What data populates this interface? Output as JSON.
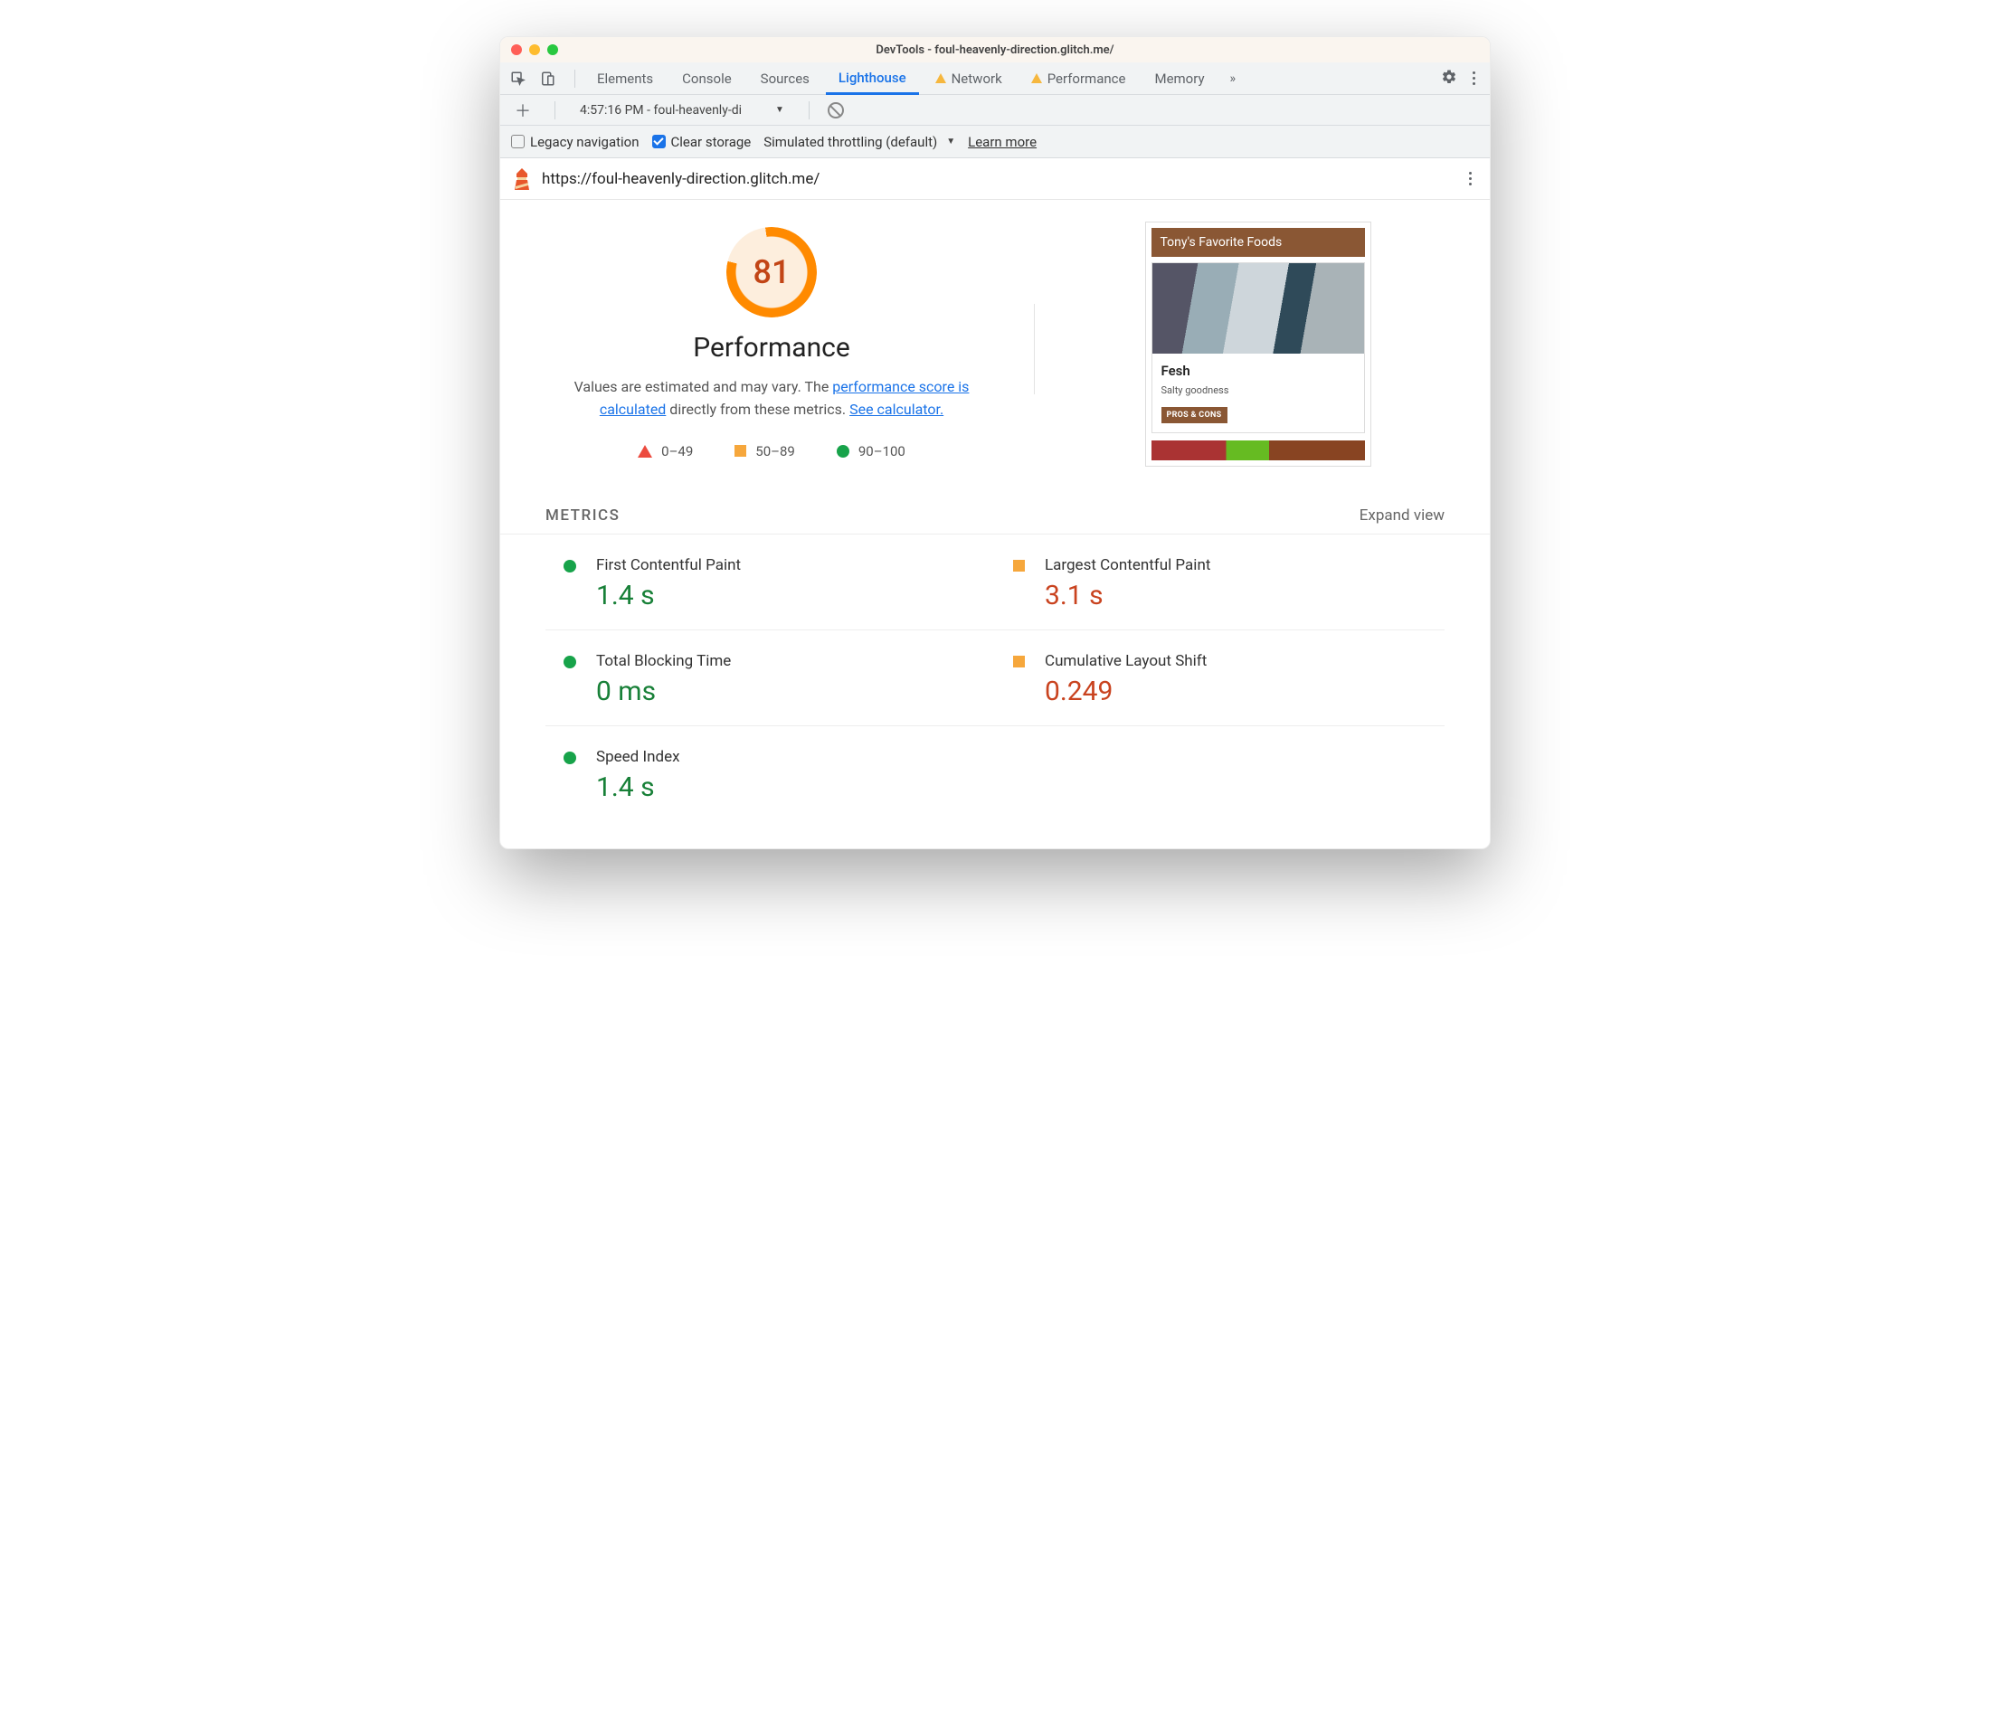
{
  "window": {
    "title": "DevTools - foul-heavenly-direction.glitch.me/"
  },
  "tabs": {
    "items": [
      "Elements",
      "Console",
      "Sources",
      "Lighthouse",
      "Network",
      "Performance",
      "Memory"
    ],
    "active": "Lighthouse",
    "warn": [
      "Network",
      "Performance"
    ]
  },
  "toolbar": {
    "run_label": "4:57:16 PM - foul-heavenly-di"
  },
  "options": {
    "legacy_label": "Legacy navigation",
    "clear_label": "Clear storage",
    "throttling_label": "Simulated throttling (default)",
    "learn_more": "Learn more"
  },
  "url": "https://foul-heavenly-direction.glitch.me/",
  "gauge": {
    "score": "81",
    "category": "Performance"
  },
  "desc": {
    "pre": "Values are estimated and may vary. The ",
    "link1": "performance score is calculated",
    "mid": " directly from these metrics. ",
    "link2": "See calculator."
  },
  "legend": {
    "a": "0–49",
    "b": "50–89",
    "c": "90–100"
  },
  "preview": {
    "header": "Tony's Favorite Foods",
    "card_title": "Fesh",
    "card_sub": "Salty goodness",
    "card_btn": "PROS & CONS"
  },
  "metrics_header": "METRICS",
  "expand_label": "Expand view",
  "metrics": [
    {
      "label": "First Contentful Paint",
      "value": "1.4 s",
      "status": "green"
    },
    {
      "label": "Largest Contentful Paint",
      "value": "3.1 s",
      "status": "orange"
    },
    {
      "label": "Total Blocking Time",
      "value": "0 ms",
      "status": "green"
    },
    {
      "label": "Cumulative Layout Shift",
      "value": "0.249",
      "status": "orange"
    },
    {
      "label": "Speed Index",
      "value": "1.4 s",
      "status": "green"
    }
  ]
}
